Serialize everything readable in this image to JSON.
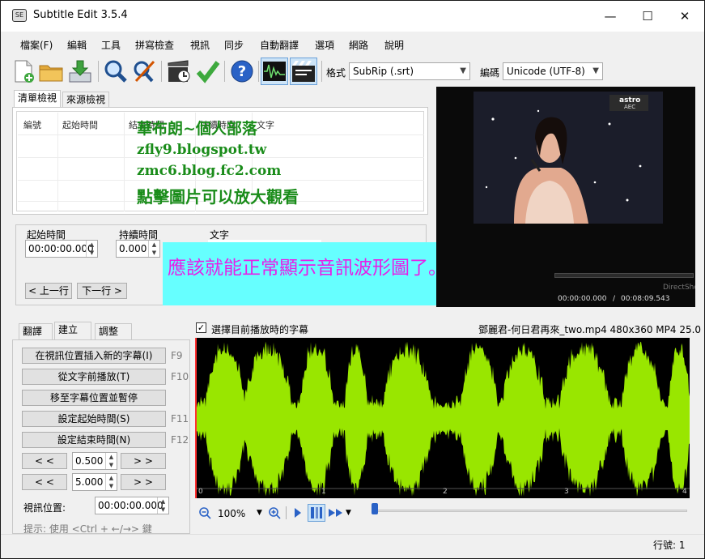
{
  "window": {
    "title": "Subtitle Edit 3.5.4",
    "icon_text": "SE",
    "minimize": "—",
    "maximize": "☐",
    "close": "✕"
  },
  "menu": [
    "檔案(F)",
    "編輯",
    "工具",
    "拼寫檢查",
    "視訊",
    "同步",
    "自動翻譯",
    "選項",
    "網路",
    "說明"
  ],
  "toolbar": {
    "format_label": "格式",
    "format_value": "SubRip (.srt)",
    "encoding_label": "編碼",
    "encoding_value": "Unicode (UTF-8)",
    "icons": [
      "new-file-icon",
      "open-folder-icon",
      "save-download-icon",
      "find-magnifier-icon",
      "replace-icon",
      "sync-clapper-icon",
      "check-icon",
      "help-icon",
      "waveform-toggle-icon",
      "video-toggle-icon"
    ]
  },
  "list_tabs": [
    "清單檢視",
    "來源檢視"
  ],
  "list_columns": [
    "編號",
    "起始時間",
    "結束時間",
    "持續時間",
    "文字"
  ],
  "overlay_lines": [
    "華布朗~個人部落",
    "zfly9.blogspot.tw",
    "zmc6.blog.fc2.com",
    "點擊圖片可以放大觀看"
  ],
  "edit": {
    "start_label": "起始時間",
    "start_value": "00:00:00.000",
    "duration_label": "持續時間",
    "duration_value": "0.000",
    "text_label": "文字",
    "prev_button": "< 上一行",
    "next_button": "下一行 >"
  },
  "banner_text": "應該就能正常顯示音訊波形圖了。",
  "video": {
    "channel_text": "astro",
    "channel_sub": "AEC",
    "current_time": "00:00:00.000",
    "total_time": "00:08:09.543",
    "player_brand": "DirectShow"
  },
  "bottom_tabs": [
    "翻譯",
    "建立",
    "調整"
  ],
  "create": {
    "buttons": [
      {
        "label": "在視訊位置插入新的字幕(I)",
        "shortcut": "F9"
      },
      {
        "label": "從文字前播放(T)",
        "shortcut": "F10"
      },
      {
        "label": "移至字幕位置並暫停",
        "shortcut": ""
      },
      {
        "label": "設定起始時間(S)",
        "shortcut": "F11"
      },
      {
        "label": "設定結束時間(N)",
        "shortcut": "F12"
      }
    ],
    "back_label": "< <",
    "forward_label": "> >",
    "step1": "0.500",
    "step2": "5.000",
    "video_pos_label": "視訊位置:",
    "video_pos_value": "00:00:00.000",
    "hint": "提示: 使用 <Ctrl + ←/→> 鍵"
  },
  "waveform": {
    "checkbox_label": "選擇目前播放時的字幕",
    "checked": true,
    "file_info": "鄧麗君-何日君再來_two.mp4 480x360 MP4 25.0",
    "marks": [
      "0",
      "1",
      "2",
      "3",
      "4"
    ],
    "zoom": "100%",
    "wave_color": "#99e600"
  },
  "status": {
    "line_label": "行號: 1"
  }
}
